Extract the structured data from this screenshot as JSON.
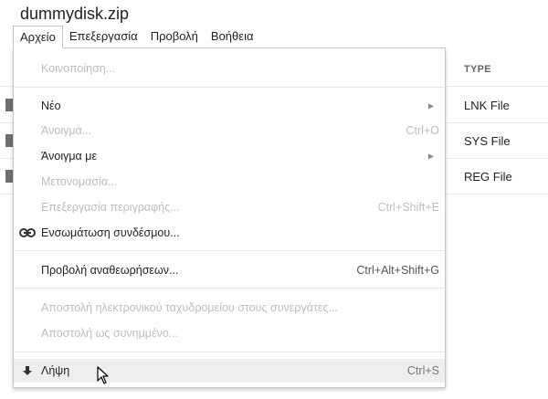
{
  "document": {
    "title": "dummydisk.zip"
  },
  "menubar": {
    "items": [
      {
        "label": "Αρχείο"
      },
      {
        "label": "Επεξεργασία"
      },
      {
        "label": "Προβολή"
      },
      {
        "label": "Βοήθεια"
      }
    ]
  },
  "file_list": {
    "type_header": "TYPE",
    "rows": [
      {
        "type": "LNK File"
      },
      {
        "type": "SYS File"
      },
      {
        "type": "REG File"
      }
    ]
  },
  "file_menu": {
    "share": {
      "label": "Κοινοποίηση..."
    },
    "new": {
      "label": "Νέο"
    },
    "open": {
      "label": "Άνοιγμα...",
      "shortcut": "Ctrl+O"
    },
    "open_with": {
      "label": "Άνοιγμα με"
    },
    "rename": {
      "label": "Μετονομασία..."
    },
    "edit_description": {
      "label": "Επεξεργασία περιγραφής...",
      "shortcut": "Ctrl+Shift+E"
    },
    "embed_link": {
      "label": "Ενσωμάτωση συνδέσμου...",
      "icon": "link-icon"
    },
    "revision_history": {
      "label": "Προβολή αναθεωρήσεων...",
      "shortcut": "Ctrl+Alt+Shift+G"
    },
    "email_collaborators": {
      "label": "Αποστολή ηλεκτρονικού ταχυδρομείου στους συνεργάτες..."
    },
    "email_attachment": {
      "label": "Αποστολή ως συνημμένο..."
    },
    "download": {
      "label": "Λήψη",
      "shortcut": "Ctrl+S",
      "icon": "download-icon"
    }
  }
}
